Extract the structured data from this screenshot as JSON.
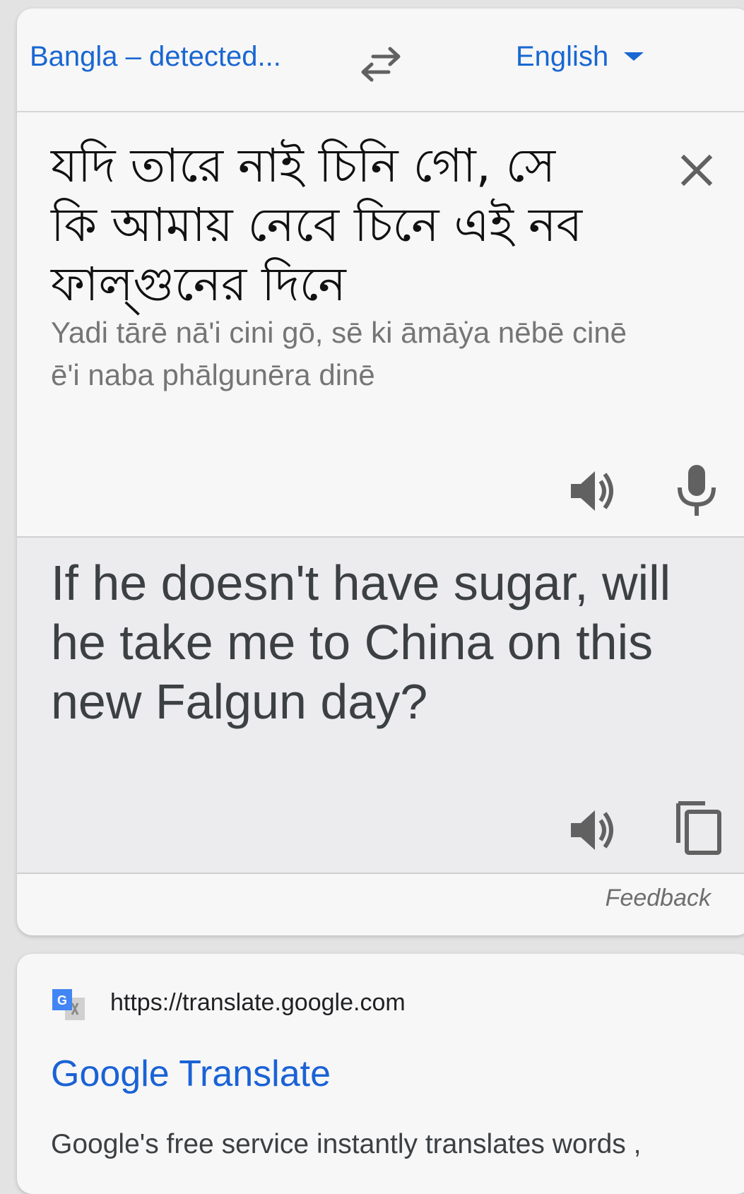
{
  "language_bar": {
    "source_language": "Bangla – detected...",
    "target_language": "English"
  },
  "source": {
    "text": "যদি তারে নাই চিনি গো, সে কি আমায় নেবে চিনে এই নব ফাল্গুনের দিনে",
    "transliteration": "Yadi tārē nā'i cini gō, sē ki āmāẏa nēbē cinē ē'i naba phālgunēra dinē"
  },
  "translation": {
    "text": "If he doesn't have sugar, will he take me to China on this new Falgun day?"
  },
  "feedback_label": "Feedback",
  "search_result": {
    "url": "https://translate.google.com",
    "title": "Google Translate",
    "snippet": "Google's free service instantly translates words ,"
  },
  "colors": {
    "accent": "#1967d2",
    "link": "#1a62d6",
    "icon": "#616161"
  },
  "icons": {
    "swap": "swap-arrows-icon",
    "clear": "close-icon",
    "speak": "speaker-icon",
    "mic": "microphone-icon",
    "copy": "copy-icon",
    "favicon": "google-translate-icon"
  }
}
